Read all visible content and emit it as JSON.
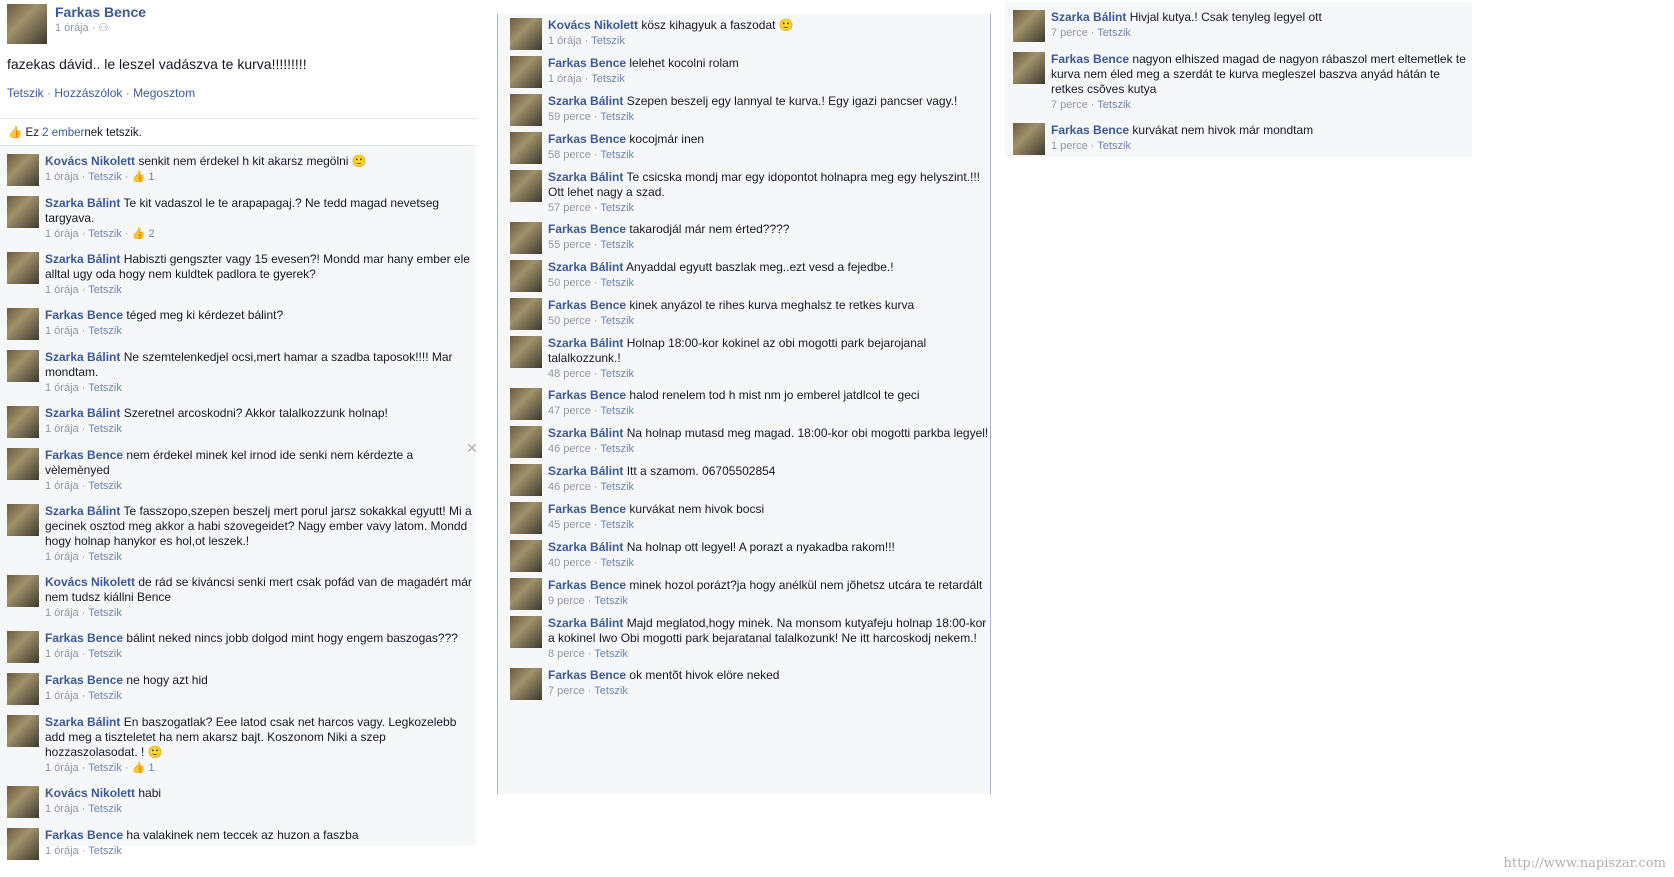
{
  "post": {
    "author": "Farkas Bence",
    "time": "1 órája",
    "privacy_icon": "friends-icon",
    "text": "fazekas dávid.. le leszel vadászva te kurva!!!!!!!!!",
    "actions": [
      "Tetszik",
      "Hozzászólok",
      "Megosztom"
    ],
    "likes_prefix": "Ez ",
    "likes_link": "2 ember",
    "likes_suffix": "nek tetszik."
  },
  "left_comments": [
    {
      "author": "Kovács Nikolett",
      "text": "senkit nem érdekel h kit akarsz megölni 🙂",
      "time": "1 órája",
      "like": "Tetszik",
      "likes": "1"
    },
    {
      "author": "Szarka Bálint",
      "text": "Te kit vadaszol le te arapapagaj.? Ne tedd magad nevetseg targyava.",
      "time": "1 órája",
      "like": "Tetszik",
      "likes": "2"
    },
    {
      "author": "Szarka Bálint",
      "text": "Habiszti gengszter vagy 15 evesen?! Mondd mar hany ember ele alltal ugy oda hogy nem kuldtek padlora te gyerek?",
      "time": "1 órája",
      "like": "Tetszik",
      "likes": ""
    },
    {
      "author": "Farkas Bence",
      "text": "téged meg ki kérdezet bálint?",
      "time": "1 órája",
      "like": "Tetszik",
      "likes": ""
    },
    {
      "author": "Szarka Bálint",
      "text": "Ne szemtelenkedjel ocsi,mert hamar a szadba taposok!!!! Mar mondtam.",
      "time": "1 órája",
      "like": "Tetszik",
      "likes": ""
    },
    {
      "author": "Szarka Bálint",
      "text": "Szeretnel arcoskodni? Akkor talalkozzunk holnap!",
      "time": "1 órája",
      "like": "Tetszik",
      "likes": ""
    },
    {
      "author": "Farkas Bence",
      "text": "nem érdekel minek kel irnod ide senki nem kérdezte a vèlemènyed",
      "time": "1 órája",
      "like": "Tetszik",
      "likes": ""
    },
    {
      "author": "Szarka Bálint",
      "text": "Te fasszopo,szepen beszelj mert porul jarsz sokakkal egyutt! Mi a gecinek osztod meg akkor a habi szovegeidet? Nagy ember vavy latom. Mondd hogy holnap hanykor es hol,ot leszek.!",
      "time": "1 órája",
      "like": "Tetszik",
      "likes": ""
    },
    {
      "author": "Kovács Nikolett",
      "text": "de rád se kiváncsi senki mert csak pofád van de magadért már nem tudsz kiállni Bence",
      "time": "1 órája",
      "like": "Tetszik",
      "likes": ""
    },
    {
      "author": "Farkas Bence",
      "text": "bálint neked nincs jobb dolgod mint hogy engem baszogas???",
      "time": "1 órája",
      "like": "Tetszik",
      "likes": ""
    },
    {
      "author": "Farkas Bence",
      "text": "ne hogy azt hid",
      "time": "1 órája",
      "like": "Tetszik",
      "likes": ""
    },
    {
      "author": "Szarka Bálint",
      "text": "En baszogatlak? Eee latod csak net harcos vagy. Legkozelebb add meg a tiszteletet ha nem akarsz bajt. Koszonom Niki a szep hozzaszolasodat. ! 🙂",
      "time": "1 órája",
      "like": "Tetszik",
      "likes": "1"
    },
    {
      "author": "Kovács Nikolett",
      "text": "habi",
      "time": "1 órája",
      "like": "Tetszik",
      "likes": ""
    },
    {
      "author": "Farkas Bence",
      "text": "ha valakinek nem teccek az huzon a faszba",
      "time": "1 órája",
      "like": "Tetszik",
      "likes": ""
    }
  ],
  "mid_comments": [
    {
      "author": "Kovács Nikolett",
      "text": "kösz kihagyuk a faszodat 🙂",
      "time": "1 órája",
      "like": "Tetszik"
    },
    {
      "author": "Farkas Bence",
      "text": "lelehet kocolni rolam",
      "time": "1 órája",
      "like": "Tetszik"
    },
    {
      "author": "Szarka Bálint",
      "text": "Szepen beszelj egy lannyal te kurva.! Egy igazi pancser vagy.!",
      "time": "59 perce",
      "like": "Tetszik"
    },
    {
      "author": "Farkas Bence",
      "text": "kocojmár inen",
      "time": "58 perce",
      "like": "Tetszik"
    },
    {
      "author": "Szarka Bálint",
      "text": "Te csicska mondj mar egy idopontot holnapra meg egy helyszint.!!! Ott lehet nagy a szad.",
      "time": "57 perce",
      "like": "Tetszik"
    },
    {
      "author": "Farkas Bence",
      "text": "takarodjál már nem érted????",
      "time": "55 perce",
      "like": "Tetszik"
    },
    {
      "author": "Szarka Bálint",
      "text": "Anyaddal egyutt baszlak meg..ezt vesd a fejedbe.!",
      "time": "50 perce",
      "like": "Tetszik"
    },
    {
      "author": "Farkas Bence",
      "text": "kinek anyázol te rihes kurva meghalsz te retkes kurva",
      "time": "50 perce",
      "like": "Tetszik"
    },
    {
      "author": "Szarka Bálint",
      "text": "Holnap 18:00-kor kokinel az obi mogotti park bejarojanal talalkozzunk.!",
      "time": "48 perce",
      "like": "Tetszik"
    },
    {
      "author": "Farkas Bence",
      "text": "halod renelem tod h mist nm jo emberel jatdlcol te geci",
      "time": "47 perce",
      "like": "Tetszik"
    },
    {
      "author": "Szarka Bálint",
      "text": "Na holnap mutasd meg magad. 18:00-kor obi mogotti parkba legyel!",
      "time": "46 perce",
      "like": "Tetszik"
    },
    {
      "author": "Szarka Bálint",
      "text": "Itt a szamom. 06705502854",
      "time": "46 perce",
      "like": "Tetszik"
    },
    {
      "author": "Farkas Bence",
      "text": "kurvákat nem hivok bocsi",
      "time": "45 perce",
      "like": "Tetszik"
    },
    {
      "author": "Szarka Bálint",
      "text": "Na holnap ott legyel! A porazt a nyakadba rakom!!!",
      "time": "40 perce",
      "like": "Tetszik"
    },
    {
      "author": "Farkas Bence",
      "text": "minek hozol porázt?ja hogy anélkül nem jõhetsz utcára te retardált",
      "time": "9 perce",
      "like": "Tetszik"
    },
    {
      "author": "Szarka Bálint",
      "text": "Majd meglatod,hogy minek. Na monsom kutyafeju holnap 18:00-kor a kokinel Iwo Obi mogotti park bejaratanal talalkozunk! Ne itt harcoskodj nekem.!",
      "time": "8 perce",
      "like": "Tetszik"
    },
    {
      "author": "Farkas Bence",
      "text": "ok mentõt hivok elöre neked",
      "time": "7 perce",
      "like": "Tetszik"
    }
  ],
  "right_comments": [
    {
      "author": "Szarka Bálint",
      "text": "Hivjal kutya.! Csak tenyleg legyel ott",
      "time": "7 perce",
      "like": "Tetszik"
    },
    {
      "author": "Farkas Bence",
      "text": "nagyon elhiszed magad de nagyon rábaszol mert eltemetlek te kurva nem éled meg a szerdát te kurva megleszel baszva anyád hátán te retkes csõves kutya",
      "time": "7 perce",
      "like": "Tetszik"
    },
    {
      "author": "Farkas Bence",
      "text": "kurvákat nem hivok már mondtam",
      "time": "1 perce",
      "like": "Tetszik"
    }
  ],
  "watermark": "http://www.napiszar.com"
}
